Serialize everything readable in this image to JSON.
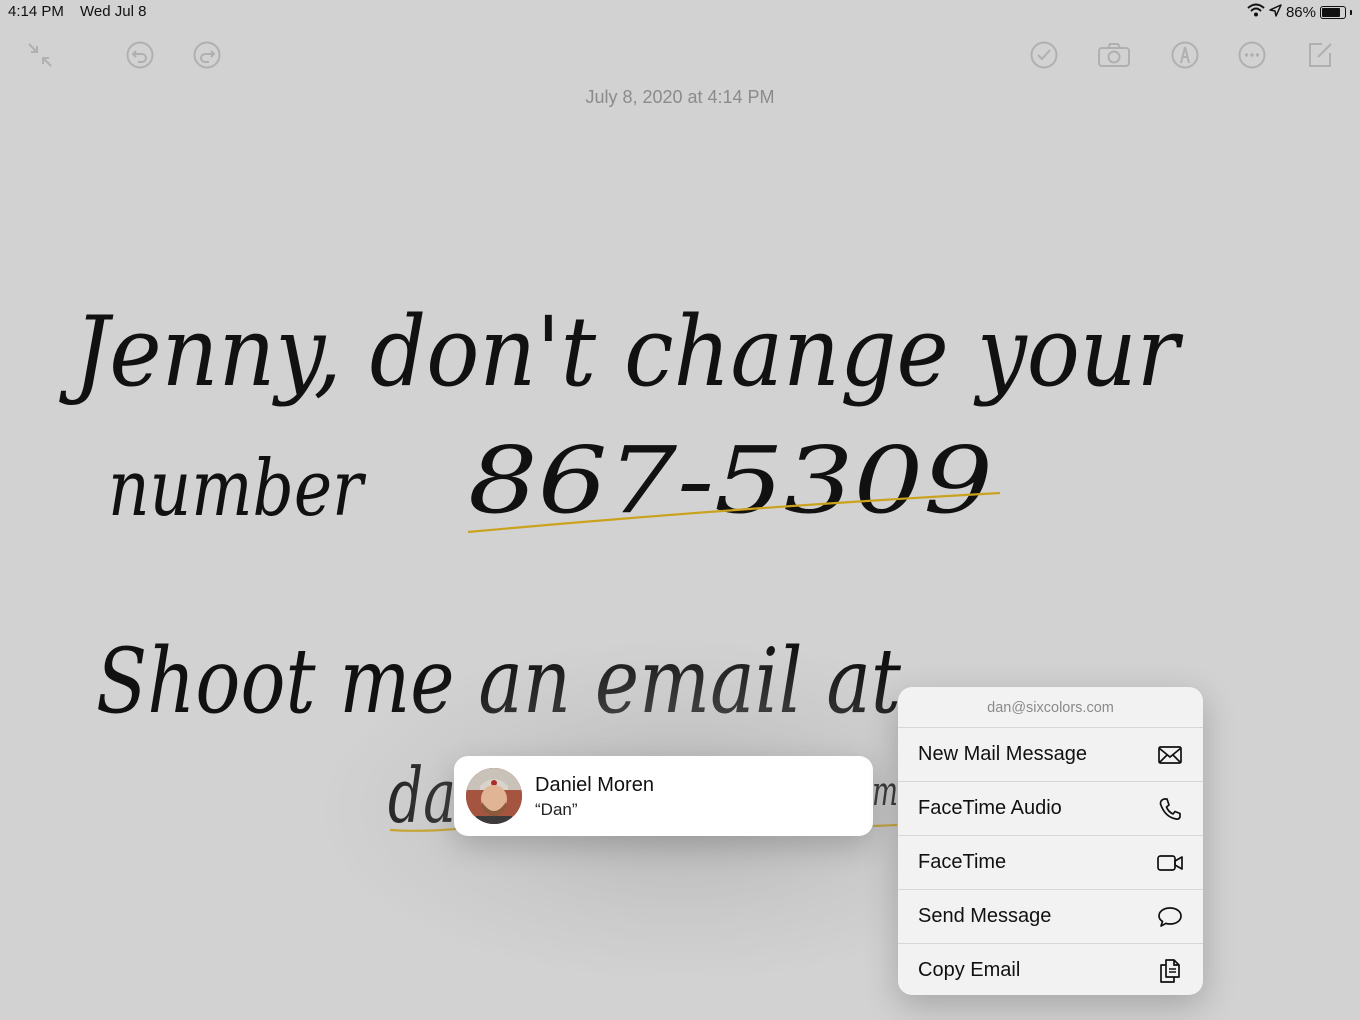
{
  "status_bar": {
    "time": "4:14 PM",
    "date": "Wed Jul 8",
    "battery_percent_label": "86%",
    "battery_level": 0.86
  },
  "toolbar": {
    "icons": [
      "collapse-icon",
      "undo-icon",
      "redo-icon",
      "checklist-icon",
      "camera-icon",
      "markup-icon",
      "more-icon",
      "compose-icon"
    ]
  },
  "note": {
    "date": "July 8, 2020 at 4:14 PM",
    "handwriting": {
      "line1": "Jenny, don't change your",
      "line2_word": "number",
      "line2_phone": "867-5309",
      "line3": "Shoot me an email at",
      "line4_start": "da",
      "line4_end": "m"
    },
    "ink_color": "#111111",
    "link_underline_color": "#caa21d"
  },
  "contact_card": {
    "name": "Daniel Moren",
    "nickname": "“Dan”"
  },
  "action_menu": {
    "header": "dan@sixcolors.com",
    "items": [
      {
        "label": "New Mail Message",
        "icon": "envelope-icon"
      },
      {
        "label": "FaceTime Audio",
        "icon": "phone-icon"
      },
      {
        "label": "FaceTime",
        "icon": "video-camera-icon"
      },
      {
        "label": "Send Message",
        "icon": "speech-bubble-icon"
      },
      {
        "label": "Copy Email",
        "icon": "copy-icon"
      }
    ]
  }
}
